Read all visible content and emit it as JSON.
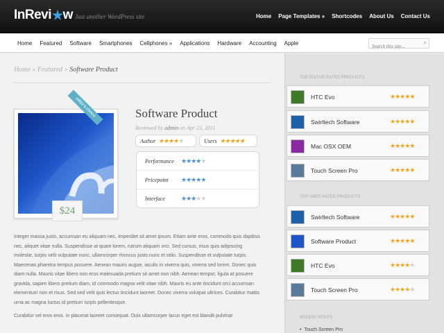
{
  "header": {
    "logo_text": "InRevi",
    "logo_star": "★",
    "logo_end": "w",
    "tagline": "Just another WordPress site",
    "nav": [
      "Home",
      "Page Templates »",
      "Shortcodes",
      "About Us",
      "Contact Us"
    ]
  },
  "categories": [
    "Home",
    "Featured",
    "Software",
    "Smartphones",
    "Cellphones »",
    "Applications",
    "Hardware",
    "Accounting",
    "Apple"
  ],
  "search": {
    "placeholder": "Search this site..."
  },
  "breadcrumb": {
    "home": "Home",
    "sep1": " » ",
    "section": "Featured",
    "sep2": " » ",
    "current": "Software Product"
  },
  "product": {
    "title": "Software Product",
    "meta_prefix": "Reviewed by ",
    "author": "admin",
    "meta_suffix": " on Apr 23, 2011",
    "price": "$24",
    "ribbon": "editor's choice",
    "author_label": "Author",
    "author_rating": 3.5,
    "users_label": "Users",
    "users_rating": 4.5,
    "ratings": [
      {
        "label": "Performance",
        "value": 3.5
      },
      {
        "label": "Pricepoint",
        "value": 5
      },
      {
        "label": "Interface",
        "value": 2.5
      }
    ]
  },
  "body": [
    "Integer massa justo, accumsan eu aliquam nec, imperdiet sit amet ipsum. Etiam ante eros, commodo quis dapibus nec, aliquet vitae nulla. Suspendisse at quam lorem, rutrum aliquam orci. Sed cursus, risus quis adipiscing molestie, turpis velit vulputate nunc, ullamcorper rhoncus justo nunc et odio. Suspendisse et vulputate turpis. Maecenas pharetra tempus posuere. Aenean mauris augue, iaculis in viverra quis, viverra sed lorem. Donec quis diam nulla. Mauris vitae libero non eros malesuada pretium sit amet non nibh. Aenean tempor, ligula at posuere gravida, sapien libero pretium diam, id commodo magna velit vitae nibh. Mauris eu ante tincidunt orci accumsan elementum non et risus. Sed sed velit quis lectus tincidunt laoreet. Donec viverra volutpat ultrices. Curabitur mattis urna ac magna luctus id pretium turpis pellentesque.",
    "Curabitur vel eros eros. In placerat laoreet consequat. Duis ullamcorper lacus eget est blandit pulvinar"
  ],
  "sidebar": {
    "editor_heading": "Top Editor Rated Products",
    "editor_items": [
      {
        "name": "HTC Evo",
        "rating": 4.5,
        "color": "#3f7a2a"
      },
      {
        "name": "Swirltech Software",
        "rating": 4.5,
        "color": "#1d5fa8"
      },
      {
        "name": "Mac OSX OEM",
        "rating": 4.5,
        "color": "#8a2aa0"
      },
      {
        "name": "Touch Screen Pro",
        "rating": 4.5,
        "color": "#5a7a9a"
      }
    ],
    "user_heading": "Top User Rated Products",
    "user_items": [
      {
        "name": "Swirltech Software",
        "rating": 5,
        "color": "#1d5fa8"
      },
      {
        "name": "Software Product",
        "rating": 4.5,
        "color": "#1e56c9"
      },
      {
        "name": "HTC Evo",
        "rating": 4,
        "color": "#3f7a2a"
      },
      {
        "name": "Touch Screen Pro",
        "rating": 4,
        "color": "#5a7a9a"
      }
    ],
    "recent_heading": "Recent Posts",
    "recent_items": [
      "Touch Screen Pro"
    ]
  }
}
